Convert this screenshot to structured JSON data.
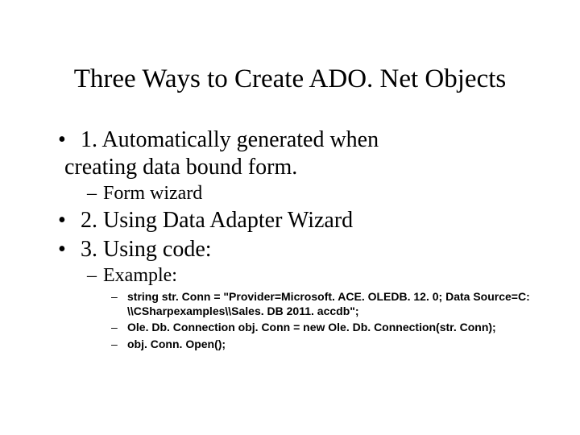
{
  "title": "Three Ways to Create ADO. Net Objects",
  "items": {
    "b1_line1": "1. Automatically generated when",
    "b1_line2": "creating data bound form.",
    "b1_sub1": "Form wizard",
    "b2": "2. Using Data Adapter Wizard",
    "b3": "3. Using code:",
    "b3_sub1": "Example:",
    "b3_code1": "string str. Conn = \"Provider=Microsoft. ACE. OLEDB. 12. 0; Data Source=C: \\\\CSharpexamples\\\\Sales. DB 2011. accdb\";",
    "b3_code2": "Ole. Db. Connection obj. Conn = new Ole. Db. Connection(str. Conn);",
    "b3_code3": "obj. Conn. Open();"
  }
}
